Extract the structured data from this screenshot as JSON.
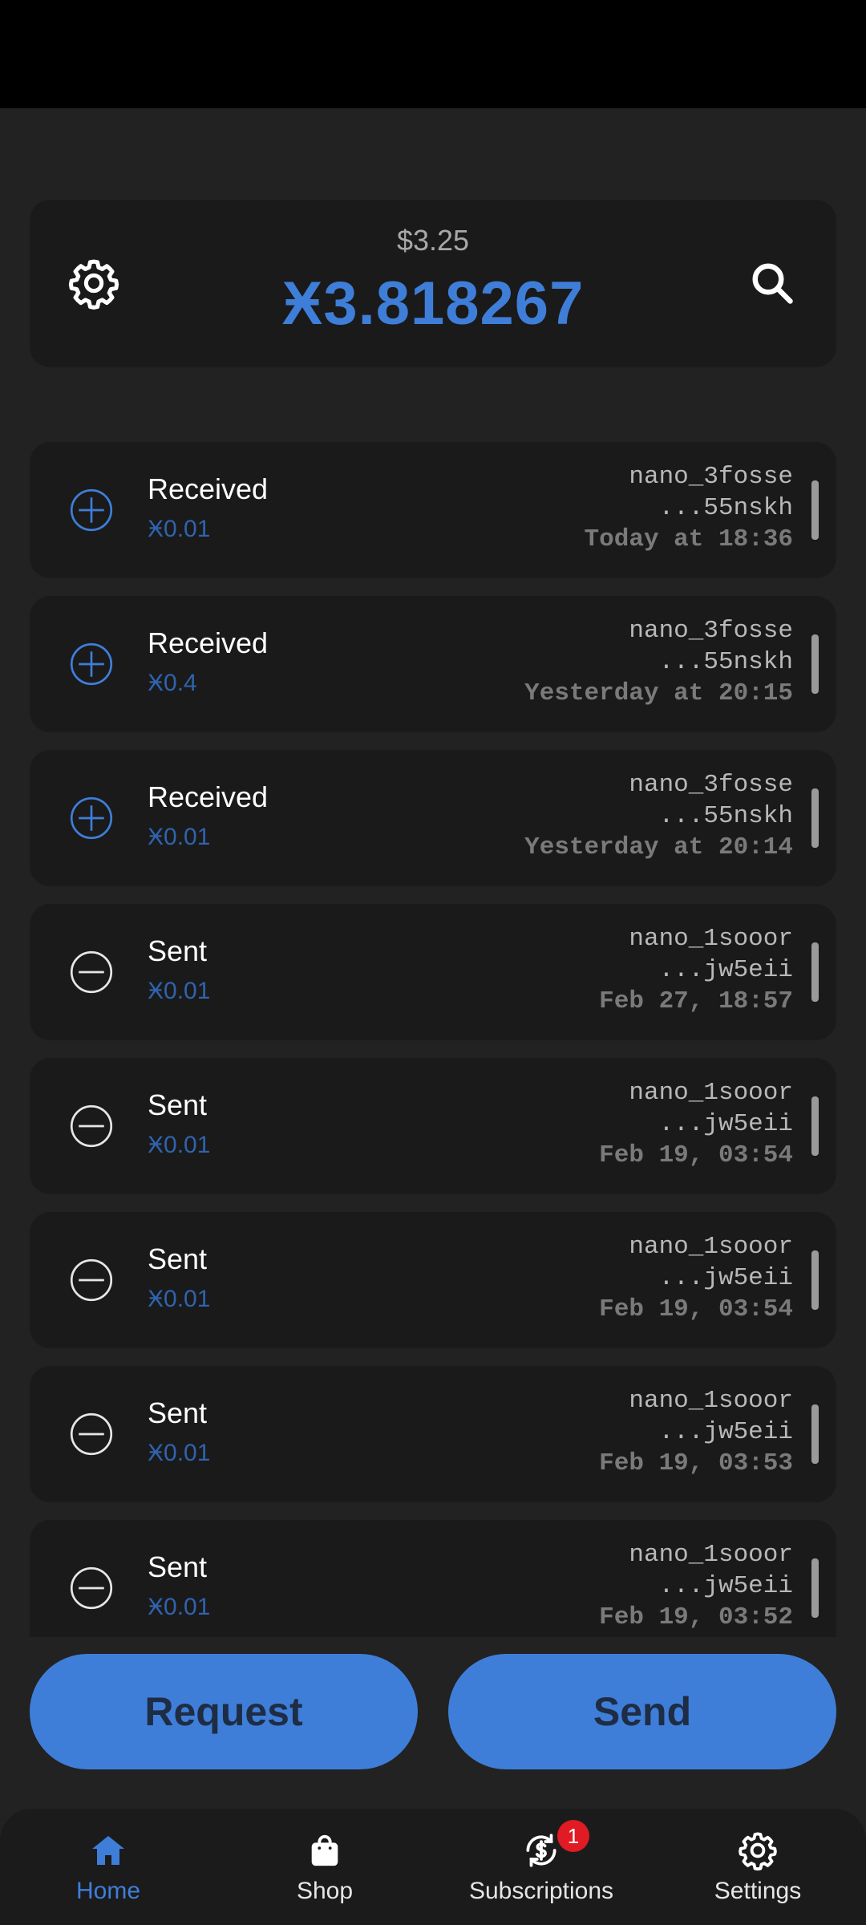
{
  "balance": {
    "fiat": "$3.25",
    "amount": "Ӿ3.818267"
  },
  "transactions": [
    {
      "kind": "received",
      "type": "Received",
      "amount": "Ӿ0.01",
      "addr1": "nano_3fosse",
      "addr2": "...55nskh",
      "date": "Today at 18:36"
    },
    {
      "kind": "received",
      "type": "Received",
      "amount": "Ӿ0.4",
      "addr1": "nano_3fosse",
      "addr2": "...55nskh",
      "date": "Yesterday at 20:15"
    },
    {
      "kind": "received",
      "type": "Received",
      "amount": "Ӿ0.01",
      "addr1": "nano_3fosse",
      "addr2": "...55nskh",
      "date": "Yesterday at 20:14"
    },
    {
      "kind": "sent",
      "type": "Sent",
      "amount": "Ӿ0.01",
      "addr1": "nano_1sooor",
      "addr2": "...jw5eii",
      "date": "Feb 27, 18:57"
    },
    {
      "kind": "sent",
      "type": "Sent",
      "amount": "Ӿ0.01",
      "addr1": "nano_1sooor",
      "addr2": "...jw5eii",
      "date": "Feb 19, 03:54"
    },
    {
      "kind": "sent",
      "type": "Sent",
      "amount": "Ӿ0.01",
      "addr1": "nano_1sooor",
      "addr2": "...jw5eii",
      "date": "Feb 19, 03:54"
    },
    {
      "kind": "sent",
      "type": "Sent",
      "amount": "Ӿ0.01",
      "addr1": "nano_1sooor",
      "addr2": "...jw5eii",
      "date": "Feb 19, 03:53"
    },
    {
      "kind": "sent",
      "type": "Sent",
      "amount": "Ӿ0.01",
      "addr1": "nano_1sooor",
      "addr2": "...jw5eii",
      "date": "Feb 19, 03:52"
    }
  ],
  "actions": {
    "request_label": "Request",
    "send_label": "Send"
  },
  "nav": {
    "items": [
      {
        "label": "Home",
        "icon": "home-icon"
      },
      {
        "label": "Shop",
        "icon": "shopping-bag-icon"
      },
      {
        "label": "Subscriptions",
        "icon": "subscriptions-icon",
        "badge": "1"
      },
      {
        "label": "Settings",
        "icon": "gear-icon"
      }
    ]
  },
  "colors": {
    "accent": "#3f7ed8",
    "background": "#222223",
    "card": "#1a1a1b",
    "badge": "#e01b24"
  }
}
